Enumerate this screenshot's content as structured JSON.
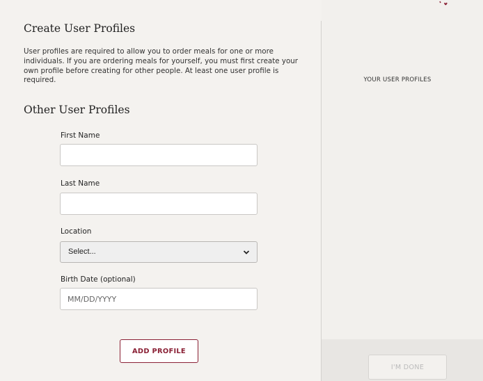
{
  "left_panel": {
    "title": "Create User Profiles",
    "intro": "User profiles are required to allow you to order meals for one or more individuals. If you are ordering meals for yourself, you must first create your own profile before creating for other people. At least one user profile is required.",
    "subtitle": "Other User Profiles",
    "form": {
      "first_name_label": "First Name",
      "first_name_value": "",
      "last_name_label": "Last Name",
      "last_name_value": "",
      "location_label": "Location",
      "location_selected": "Select...",
      "birth_date_label": "Birth Date (optional)",
      "birth_date_placeholder": "MM/DD/YYYY"
    },
    "add_profile_label": "ADD PROFILE"
  },
  "right_panel": {
    "heading": "YOUR USER PROFILES",
    "done_label": "I'M DONE"
  },
  "colors": {
    "accent": "#8a2035",
    "background": "#f3f1ee",
    "disabled_text": "#bbbbbb"
  },
  "icons": {
    "select_chevron": "chevron-down-icon"
  }
}
